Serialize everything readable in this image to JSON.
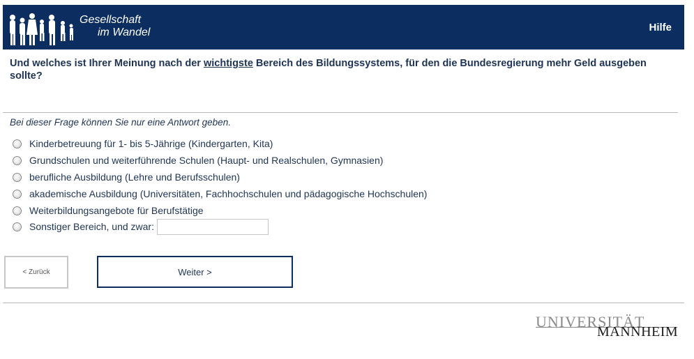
{
  "header": {
    "logo_line1": "Gesellschaft",
    "logo_line2": "im Wandel",
    "help_label": "Hilfe"
  },
  "question": {
    "prefix": "Und welches ist Ihrer Meinung nach der ",
    "underlined": "wichtigste",
    "suffix": " Bereich des Bildungssystems, für den die Bundesregierung mehr Geld ausgeben sollte?"
  },
  "instruction": "Bei dieser Frage können Sie nur eine Antwort geben.",
  "options": [
    "Kinderbetreuung für 1- bis 5-Jährige (Kindergarten, Kita)",
    "Grundschulen und weiterführende Schulen (Haupt- und Realschulen, Gymnasien)",
    "berufliche Ausbildung (Lehre und Berufsschulen)",
    "akademische Ausbildung (Universitäten, Fachhochschulen und pädagogische Hochschulen)",
    "Weiterbildungsangebote für Berufstätige",
    "Sonstiger Bereich, und zwar:"
  ],
  "other_input_value": "",
  "nav": {
    "back_label": "< Zurück",
    "next_label": "Weiter >"
  },
  "footer": {
    "uni_line1": "UNIVERSITÄT",
    "uni_line2": "MANNHEIM"
  },
  "colors": {
    "brand": "#0b2d5f",
    "text": "#1f3455"
  }
}
